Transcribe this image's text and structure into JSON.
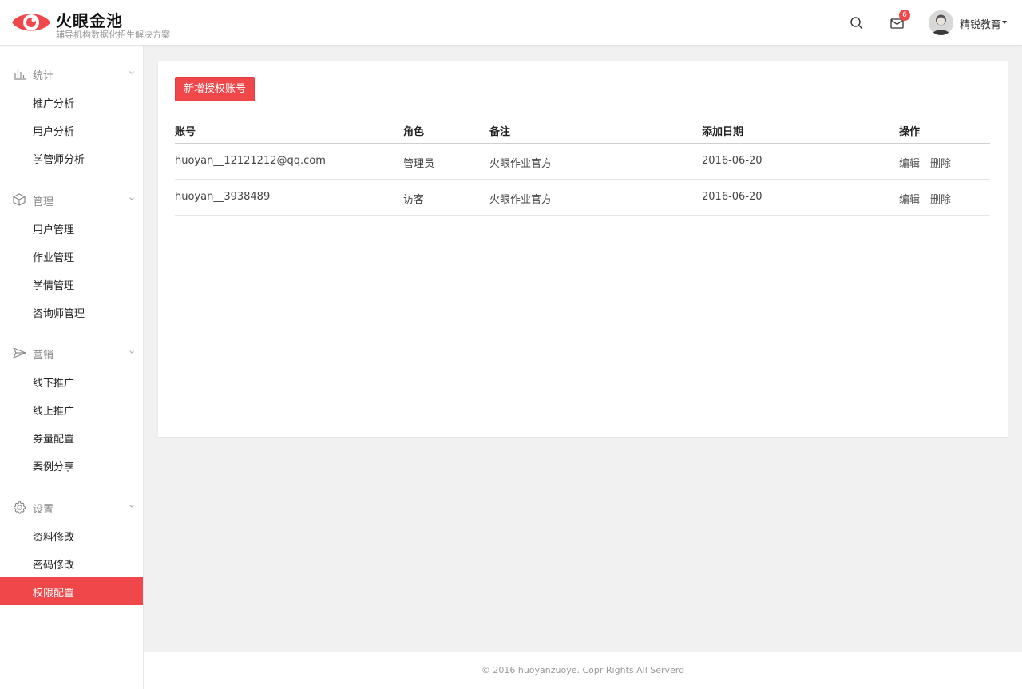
{
  "header": {
    "title": "火眼金池",
    "subtitle": "辅导机构数据化招生解决方案",
    "mail_badge": "6",
    "user_name": "精锐教育",
    "icons": {
      "logo": "eye-logo-icon",
      "search": "search-icon",
      "mail": "mail-icon",
      "caret": "caret-down-icon"
    },
    "accent_color": "#f0474a"
  },
  "sidebar": {
    "groups": [
      {
        "label": "统计",
        "icon": "bar-chart-icon",
        "items": [
          "推广分析",
          "用户分析",
          "学管师分析"
        ]
      },
      {
        "label": "管理",
        "icon": "cube-icon",
        "items": [
          "用户管理",
          "作业管理",
          "学情管理",
          "咨询师管理"
        ]
      },
      {
        "label": "营销",
        "icon": "paper-plane-icon",
        "items": [
          "线下推广",
          "线上推广",
          "券量配置",
          "案例分享"
        ]
      },
      {
        "label": "设置",
        "icon": "gear-icon",
        "items": [
          "资料修改",
          "密码修改",
          "权限配置"
        ]
      }
    ],
    "active_item": "权限配置"
  },
  "main": {
    "add_button": "新增授权账号",
    "columns": [
      "账号",
      "角色",
      "备注",
      "添加日期",
      "操作"
    ],
    "rows": [
      {
        "account": "huoyan__12121212@qq.com",
        "role": "管理员",
        "note": "火眼作业官方",
        "date": "2016-06-20",
        "edit": "编辑",
        "delete": "删除"
      },
      {
        "account": "huoyan__3938489",
        "role": "访客",
        "note": "火眼作业官方",
        "date": "2016-06-20",
        "edit": "编辑",
        "delete": "删除"
      }
    ]
  },
  "footer": {
    "text": "© 2016 huoyanzuoye. Copr Rights All Serverd"
  }
}
